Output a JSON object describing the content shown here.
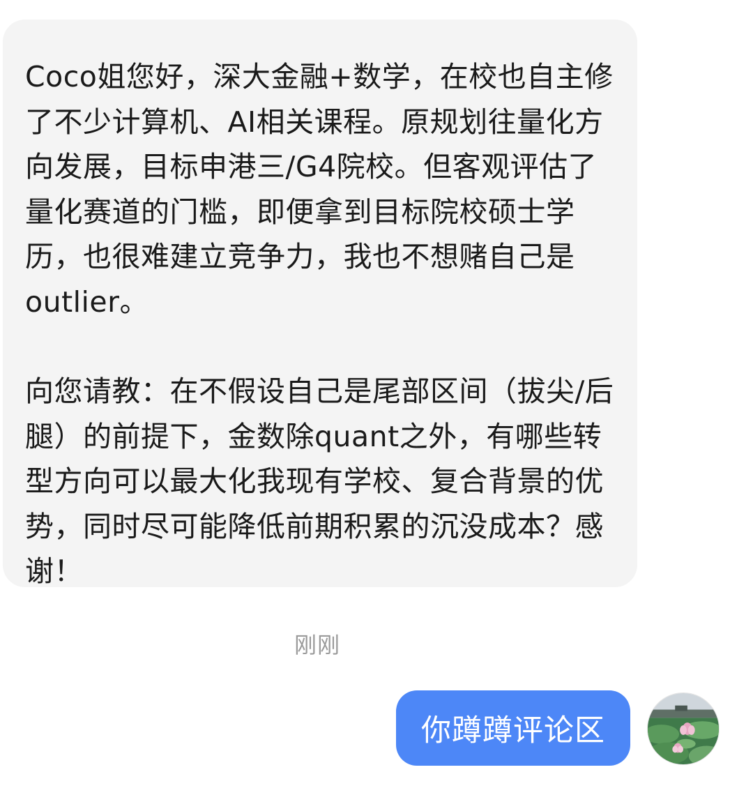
{
  "conversation": {
    "incoming_message": {
      "paragraph_1": "Coco姐您好，深大金融+数学，在校也自主修了不少计算机、AI相关课程。原规划往量化方向发展，目标申港三/G4院校。但客观评估了量化赛道的门槛，即便拿到目标院校硕士学历，也很难建立竞争力，我也不想赌自己是outlier。",
      "paragraph_2": "向您请教：在不假设自己是尾部区间（拔尖/后腿）的前提下，金数除quant之外，有哪些转型方向可以最大化我现有学校、复合背景的优势，同时尽可能降低前期积累的沉没成本？感谢！"
    },
    "timestamp": "刚刚",
    "outgoing_message": {
      "text": "你蹲蹲评论区"
    },
    "avatar_icon": "lotus-avatar-icon"
  },
  "colors": {
    "incoming_bubble": "#f4f4f4",
    "outgoing_bubble": "#4d87f7",
    "timestamp_text": "#9a9a9a",
    "message_text": "#1a1a1a"
  }
}
